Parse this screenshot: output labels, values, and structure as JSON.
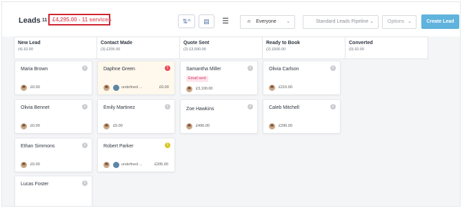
{
  "header": {
    "title": "Leads",
    "count": "11",
    "total_summary": "£4,295.00 - 11 services",
    "sort_icon": "sort-arrows-icon",
    "board_icon": "board-view-icon",
    "list_icon": "list-view-icon"
  },
  "filters": {
    "owner": "Everyone",
    "pipeline": "Standard Leads Pipeline",
    "options": "Options",
    "create_label": "Create Lead"
  },
  "columns": [
    {
      "title": "New Lead",
      "summary": "(4) £0.00",
      "cards": [
        {
          "name": "Maria Brown",
          "price": "£0.00"
        },
        {
          "name": "Olivia Bennet",
          "price": "£0.00"
        },
        {
          "name": "Ethan Simmons",
          "price": "£0.00"
        },
        {
          "name": "Lucas Foster",
          "price": ""
        }
      ]
    },
    {
      "title": "Contact Made",
      "summary": "(3) £205.00",
      "cards": [
        {
          "name": "Daphne Green",
          "price": "£0.00",
          "assignee": "undefined ...",
          "flag": "!"
        },
        {
          "name": "Emily Martinez",
          "price": "£0.00"
        },
        {
          "name": "Robert Parker",
          "price": "£205.00",
          "assignee": "undefined ...",
          "flag": "!"
        }
      ]
    },
    {
      "title": "Quote Sent",
      "summary": "(2) £3,590.00",
      "cards": [
        {
          "name": "Samantha Miller",
          "price": "£3,100.00",
          "badge": "Email sent"
        },
        {
          "name": "Zoe Hawkins",
          "price": "£490.00"
        }
      ]
    },
    {
      "title": "Ready to Book",
      "summary": "(2) £500.00",
      "cards": [
        {
          "name": "Olivia Carlson",
          "price": "£210.00"
        },
        {
          "name": "Caleb Mitchell",
          "price": "£290.00"
        }
      ]
    },
    {
      "title": "Converted",
      "summary": "(0) £0.00",
      "cards": []
    }
  ]
}
